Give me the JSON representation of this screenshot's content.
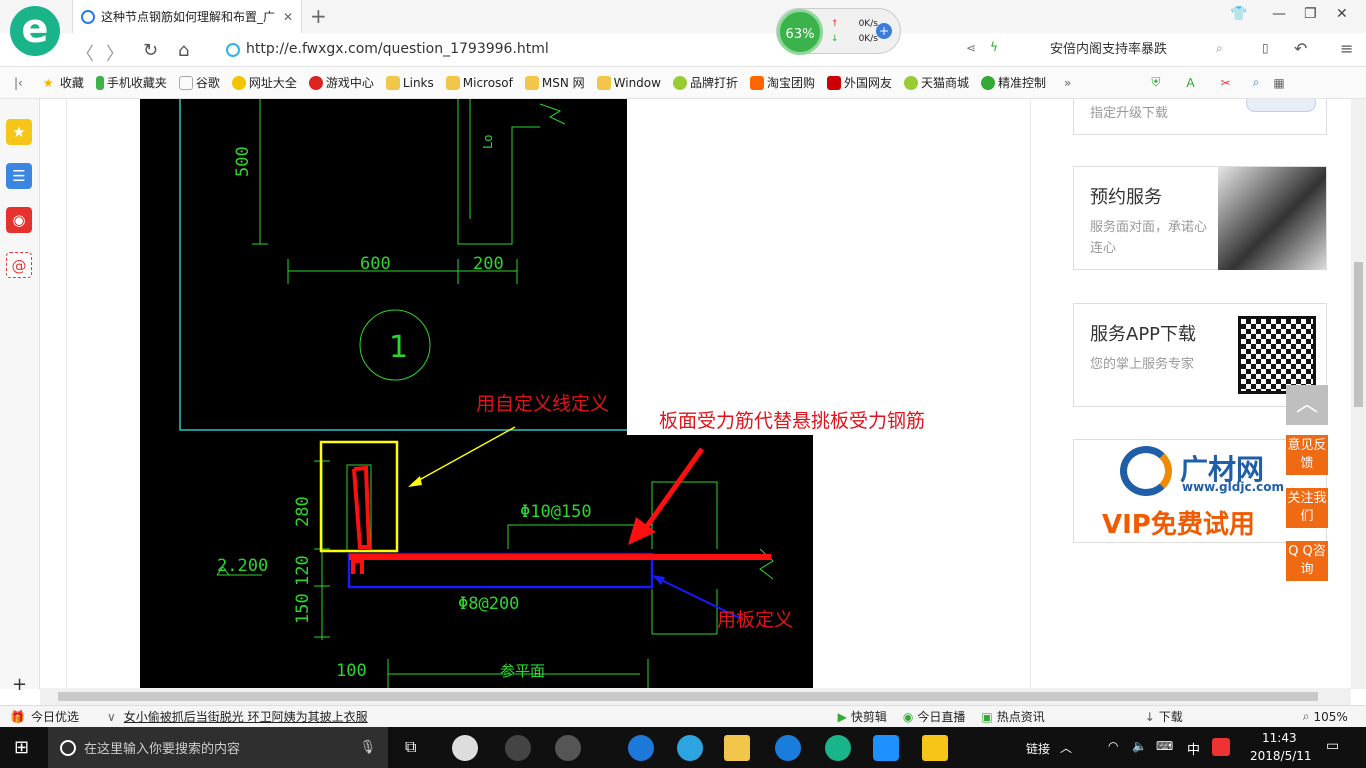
{
  "browser": {
    "tab_title": "这种节点钢筋如何理解和布置_广",
    "url": "http://e.fwxgx.com/question_1793996.html",
    "search_text": "安倍内阁支持率暴跌",
    "speed_percent": "63%",
    "up_speed": "0K/s",
    "down_speed": "0K/s"
  },
  "bookmarks": [
    "收藏",
    "手机收藏夹",
    "谷歌",
    "网址大全",
    "游戏中心",
    "Links",
    "Microsof",
    "MSN 网",
    "Window",
    "品牌打折",
    "淘宝团购",
    "外国网友",
    "天猫商城",
    "精准控制"
  ],
  "cad": {
    "dims": {
      "d500": "500",
      "d600": "600",
      "d200": "200",
      "d280": "280",
      "d120": "120",
      "d150": "150",
      "d100": "100",
      "level": "2.200",
      "lo": "Lo",
      "circle": "1"
    },
    "rebar_top": "Φ10@150",
    "rebar_bottom": "Φ8@200",
    "section": "参平面"
  },
  "annotations": {
    "custom_line": "用自定义线定义",
    "board_rebar": "板面受力筋代替悬挑板受力钢筋",
    "board_def": "用板定义"
  },
  "sidebar_cards": {
    "upgrade": "指定升级下载",
    "booking_title": "预约服务",
    "booking_sub": "服务面对面，承诺心连心",
    "app_title": "服务APP下载",
    "app_sub": "您的掌上服务专家",
    "ad_brand": "广材网",
    "ad_url": "www.gldjc.com",
    "ad_vip": "VIP免费试用"
  },
  "float_buttons": {
    "feedback": "意见反馈",
    "follow": "关注我们",
    "qq": "Q Q咨询"
  },
  "status_bar": {
    "today": "今日优选",
    "news": "女小偷被抓后当街脱光 环卫阿姨为其披上衣服",
    "kuaijian": "快剪辑",
    "live": "今日直播",
    "hot": "热点资讯",
    "download": "下载",
    "zoom": "105%"
  },
  "taskbar": {
    "search_placeholder": "在这里输入你要搜索的内容",
    "link": "链接",
    "ime": "中",
    "time": "11:43",
    "date": "2018/5/11"
  }
}
